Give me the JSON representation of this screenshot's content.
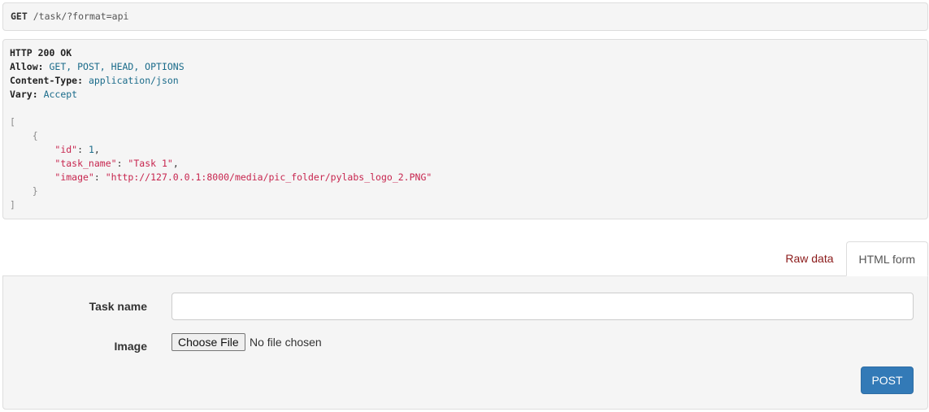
{
  "request": {
    "method": "GET",
    "path": "/task/?format=api"
  },
  "response": {
    "status_line": "HTTP 200 OK",
    "headers": [
      {
        "name": "Allow:",
        "value": "GET, POST, HEAD, OPTIONS"
      },
      {
        "name": "Content-Type:",
        "value": "application/json"
      },
      {
        "name": "Vary:",
        "value": "Accept"
      }
    ],
    "body": {
      "open_bracket": "[",
      "open_brace": "{",
      "fields": [
        {
          "key": "\"id\"",
          "value": "1",
          "type": "number",
          "comma": ","
        },
        {
          "key": "\"task_name\"",
          "value": "\"Task 1\"",
          "type": "string",
          "comma": ","
        },
        {
          "key": "\"image\"",
          "value": "\"http://127.0.0.1:8000/media/pic_folder/pylabs_logo_2.PNG\"",
          "type": "string",
          "comma": ""
        }
      ],
      "close_brace": "}",
      "close_bracket": "]"
    }
  },
  "tabs": {
    "raw_label": "Raw data",
    "html_label": "HTML form",
    "active": "HTML form"
  },
  "form": {
    "task_name_label": "Task name",
    "task_name_value": "",
    "image_label": "Image",
    "file_button_label": "Choose File",
    "file_status": "No file chosen",
    "submit_label": "POST"
  },
  "colors": {
    "submit_bg": "#337ab7",
    "raw_tab_text": "#8b1a1a",
    "json_key": "#c7254e",
    "header_value": "#1a6b8a"
  }
}
